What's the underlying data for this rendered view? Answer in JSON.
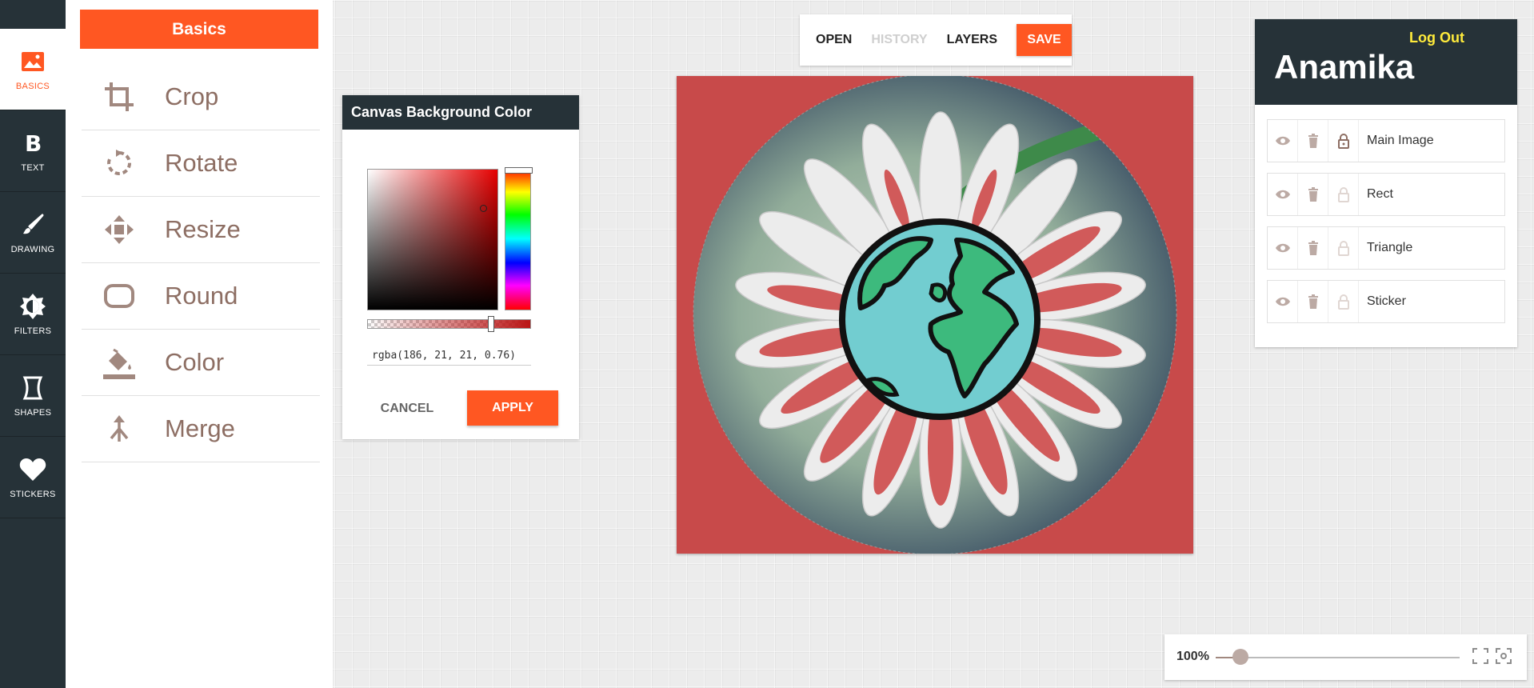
{
  "colors": {
    "accent": "#ff5722",
    "dark": "#263238",
    "tool_icon": "#a1887f",
    "logout": "#ffeb3b",
    "canvas_bg": "#c84a4a"
  },
  "leftnav": {
    "items": [
      {
        "label": "BASICS",
        "icon": "image-icon",
        "active": true
      },
      {
        "label": "TEXT",
        "icon": "bold-icon"
      },
      {
        "label": "DRAWING",
        "icon": "brush-icon"
      },
      {
        "label": "FILTERS",
        "icon": "brightness-icon"
      },
      {
        "label": "SHAPES",
        "icon": "shape-icon"
      },
      {
        "label": "STICKERS",
        "icon": "heart-icon"
      }
    ]
  },
  "basics": {
    "title": "Basics",
    "tools": [
      {
        "label": "Crop",
        "icon": "crop-icon"
      },
      {
        "label": "Rotate",
        "icon": "rotate-icon"
      },
      {
        "label": "Resize",
        "icon": "move-icon"
      },
      {
        "label": "Round",
        "icon": "rounded-rect-icon"
      },
      {
        "label": "Color",
        "icon": "paint-bucket-icon"
      },
      {
        "label": "Merge",
        "icon": "merge-icon"
      }
    ]
  },
  "color_dialog": {
    "title": "Canvas Background Color",
    "value": "rgba(186, 21, 21, 0.76)",
    "alpha": 0.76,
    "cancel_label": "CANCEL",
    "apply_label": "APPLY"
  },
  "toolbar": {
    "open_label": "OPEN",
    "history_label": "HISTORY",
    "layers_label": "LAYERS",
    "save_label": "SAVE"
  },
  "user_panel": {
    "logout_label": "Log Out",
    "username": "Anamika"
  },
  "layers": [
    {
      "name": "Main Image",
      "locked": true
    },
    {
      "name": "Rect",
      "locked": false
    },
    {
      "name": "Triangle",
      "locked": false
    },
    {
      "name": "Sticker",
      "locked": false
    }
  ],
  "zoom": {
    "label": "100%",
    "fraction": 0.1
  }
}
